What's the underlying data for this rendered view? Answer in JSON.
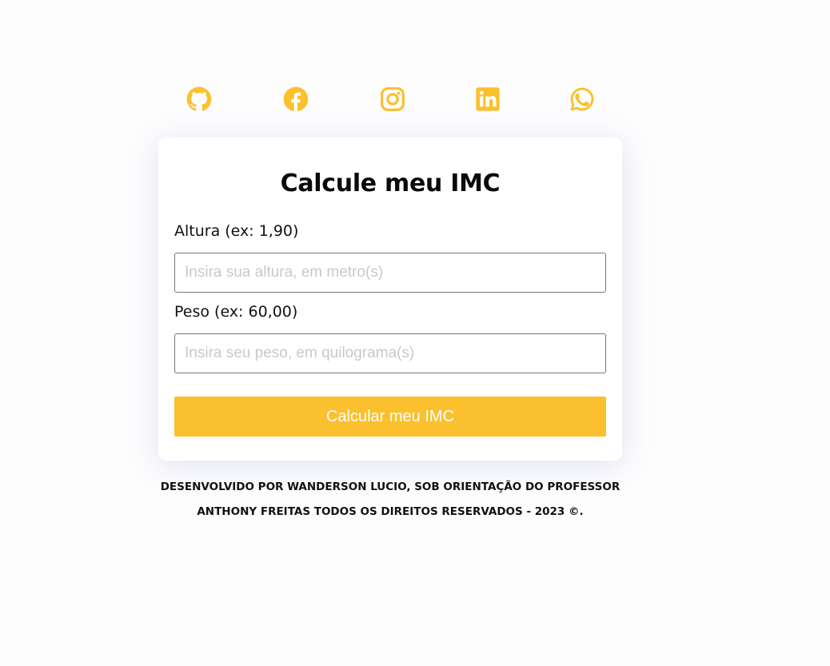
{
  "social": {
    "accent_color": "#fbc02d",
    "icons": [
      "github-icon",
      "facebook-icon",
      "instagram-icon",
      "linkedin-icon",
      "whatsapp-icon"
    ]
  },
  "card": {
    "title": "Calcule meu IMC",
    "height_label": "Altura (ex: 1,90)",
    "height_placeholder": "Insira sua altura, em metro(s)",
    "height_value": "",
    "weight_label": "Peso (ex: 60,00)",
    "weight_placeholder": "Insira seu peso, em quilograma(s)",
    "weight_value": "",
    "button_label": "Calcular meu IMC",
    "button_color": "#fbc02d"
  },
  "footer": {
    "line1": "DESENVOLVIDO POR WANDERSON LUCIO, SOB ORIENTAÇÃO DO PROFESSOR",
    "line2": "ANTHONY FREITAS TODOS OS DIREITOS RESERVADOS - 2023 ©."
  }
}
